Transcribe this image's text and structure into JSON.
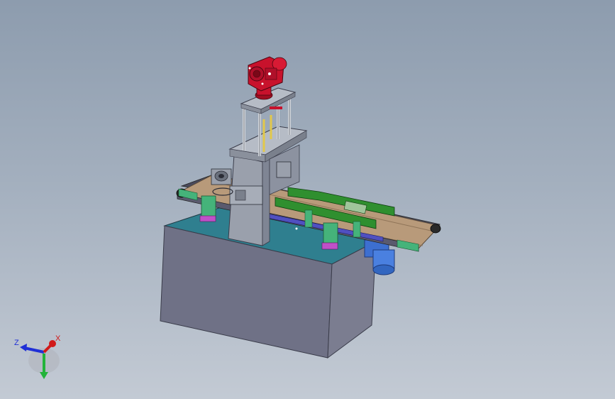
{
  "view": {
    "triad": {
      "z_label": "Z",
      "x_label": "X",
      "colors": {
        "x": "#d11a1a",
        "y": "#23b33a",
        "z": "#1f2fd6"
      }
    }
  },
  "colors": {
    "background_top": "#8d9cae",
    "background_bottom": "#c3cad4",
    "base_top": "#2f7f8f",
    "base_front": "#6f7186",
    "base_side": "#7b7d90",
    "motor": "#c8122c",
    "belt": "#b89a7a",
    "guide_rails": "#2f8f2f",
    "brackets": "#45b37a",
    "mounts": "#c050c8",
    "blue_motor": "#3d6fd0",
    "frame_metal": "#a0a6b0"
  }
}
